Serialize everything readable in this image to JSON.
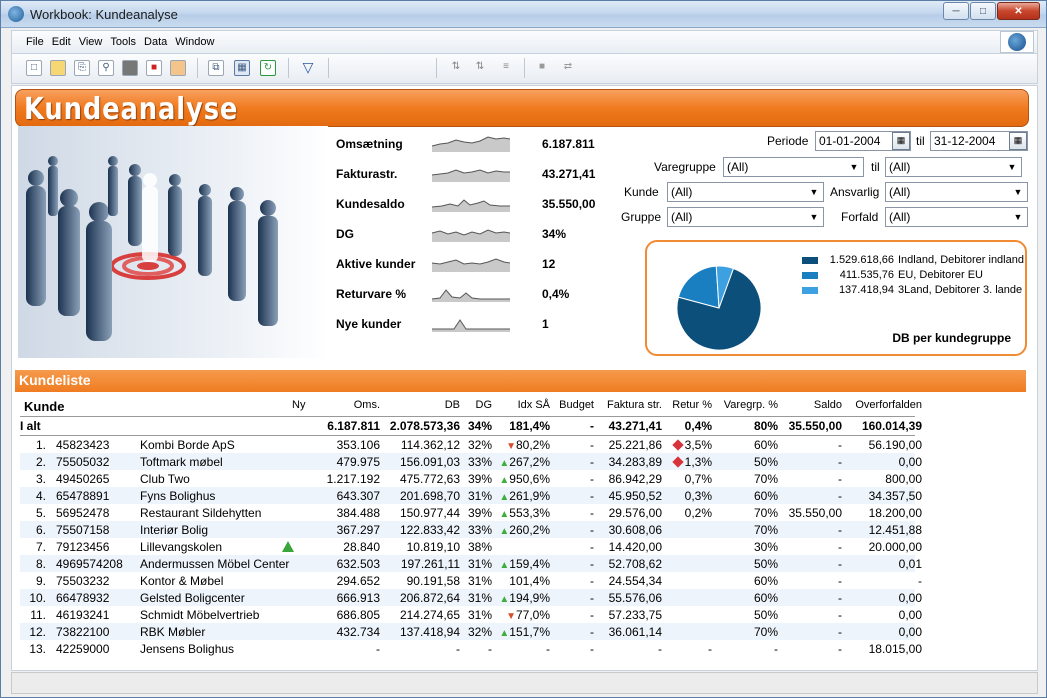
{
  "window": {
    "title": "Workbook: Kundeanalyse"
  },
  "menu": [
    "File",
    "Edit",
    "View",
    "Tools",
    "Data",
    "Window"
  ],
  "banner": {
    "title": "Kundeanalyse"
  },
  "kpis": [
    {
      "label": "Omsætning",
      "value": "6.187.811"
    },
    {
      "label": "Fakturastr.",
      "value": "43.271,41"
    },
    {
      "label": "Kundesaldo",
      "value": "35.550,00"
    },
    {
      "label": "DG",
      "value": "34%"
    },
    {
      "label": "Aktive kunder",
      "value": "12"
    },
    {
      "label": "Returvare %",
      "value": "0,4%"
    },
    {
      "label": "Nye kunder",
      "value": "1"
    }
  ],
  "filters": {
    "periode_label": "Periode",
    "periode_from": "01-01-2004",
    "til_label": "til",
    "periode_to": "31-12-2004",
    "varegruppe_label": "Varegruppe",
    "varegruppe_value": "(All)",
    "varegruppe_til_label": "til",
    "varegruppe_til_value": "(All)",
    "kunde_label": "Kunde",
    "kunde_value": "(All)",
    "ansvarlig_label": "Ansvarlig",
    "ansvarlig_value": "(All)",
    "gruppe_label": "Gruppe",
    "gruppe_value": "(All)",
    "forfald_label": "Forfald",
    "forfald_value": "(All)"
  },
  "chart_data": {
    "type": "pie",
    "title": "DB per kundegruppe",
    "categories": [
      "Indland, Debitorer indland",
      "EU, Debitorer EU",
      "3Land, Debitorer 3. lande"
    ],
    "values": [
      1529618.66,
      411535.76,
      137418.94
    ],
    "value_labels": [
      "1.529.618,66",
      "411.535,76",
      "137.418,94"
    ],
    "colors": [
      "#0b4f7a",
      "#1a7fc1",
      "#3da0e0"
    ],
    "legend": "top-right"
  },
  "kundeliste": {
    "title": "Kundeliste",
    "headers": {
      "kunde": "Kunde",
      "ny": "Ny",
      "oms": "Oms.",
      "db": "DB",
      "dg": "DG",
      "idx": "Idx SÅ",
      "budget": "Budget",
      "faktura": "Faktura str.",
      "retur": "Retur %",
      "varegrp": "Varegrp. %",
      "saldo": "Saldo",
      "overforfalden": "Overforfalden"
    },
    "total": {
      "label": "I alt",
      "oms": "6.187.811",
      "db": "2.078.573,36",
      "dg": "34%",
      "idx": "181,4%",
      "budget": "-",
      "faktura": "43.271,41",
      "retur": "0,4%",
      "varegrp": "80%",
      "saldo": "35.550,00",
      "overforfalden": "160.014,39"
    },
    "rows": [
      {
        "nr": "1.",
        "id": "45823423",
        "name": "Kombi Borde ApS",
        "ny": false,
        "oms": "353.106",
        "db": "114.362,12",
        "dg": "32%",
        "trend": "down",
        "idx": "80,2%",
        "budget": "-",
        "faktura": "25.221,86",
        "retur_flag": true,
        "retur": "3,5%",
        "varegrp": "60%",
        "saldo": "-",
        "overforfalden": "56.190,00"
      },
      {
        "nr": "2.",
        "id": "75505032",
        "name": "Toftmark møbel",
        "ny": false,
        "oms": "479.975",
        "db": "156.091,03",
        "dg": "33%",
        "trend": "up",
        "idx": "267,2%",
        "budget": "-",
        "faktura": "34.283,89",
        "retur_flag": true,
        "retur": "1,3%",
        "varegrp": "50%",
        "saldo": "-",
        "overforfalden": "0,00"
      },
      {
        "nr": "3.",
        "id": "49450265",
        "name": "Club Two",
        "ny": false,
        "oms": "1.217.192",
        "db": "475.772,63",
        "dg": "39%",
        "trend": "up",
        "idx": "950,6%",
        "budget": "-",
        "faktura": "86.942,29",
        "retur_flag": false,
        "retur": "0,7%",
        "varegrp": "70%",
        "saldo": "-",
        "overforfalden": "800,00"
      },
      {
        "nr": "4.",
        "id": "65478891",
        "name": "Fyns Bolighus",
        "ny": false,
        "oms": "643.307",
        "db": "201.698,70",
        "dg": "31%",
        "trend": "up",
        "idx": "261,9%",
        "budget": "-",
        "faktura": "45.950,52",
        "retur_flag": false,
        "retur": "0,3%",
        "varegrp": "60%",
        "saldo": "-",
        "overforfalden": "34.357,50"
      },
      {
        "nr": "5.",
        "id": "56952478",
        "name": "Restaurant Sildehytten",
        "ny": false,
        "oms": "384.488",
        "db": "150.977,44",
        "dg": "39%",
        "trend": "up",
        "idx": "553,3%",
        "budget": "-",
        "faktura": "29.576,00",
        "retur_flag": false,
        "retur": "0,2%",
        "varegrp": "70%",
        "saldo": "35.550,00",
        "overforfalden": "18.200,00"
      },
      {
        "nr": "6.",
        "id": "75507158",
        "name": "Interiør Bolig",
        "ny": false,
        "oms": "367.297",
        "db": "122.833,42",
        "dg": "33%",
        "trend": "up",
        "idx": "260,2%",
        "budget": "-",
        "faktura": "30.608,06",
        "retur_flag": false,
        "retur": "",
        "varegrp": "70%",
        "saldo": "-",
        "overforfalden": "12.451,88"
      },
      {
        "nr": "7.",
        "id": "79123456",
        "name": "Lillevangskolen",
        "ny": true,
        "oms": "28.840",
        "db": "10.819,10",
        "dg": "38%",
        "trend": "",
        "idx": "",
        "budget": "-",
        "faktura": "14.420,00",
        "retur_flag": false,
        "retur": "",
        "varegrp": "30%",
        "saldo": "-",
        "overforfalden": "20.000,00"
      },
      {
        "nr": "8.",
        "id": "4969574208",
        "name": "Andermussen Möbel Center",
        "ny": false,
        "oms": "632.503",
        "db": "197.261,11",
        "dg": "31%",
        "trend": "up",
        "idx": "159,4%",
        "budget": "-",
        "faktura": "52.708,62",
        "retur_flag": false,
        "retur": "",
        "varegrp": "50%",
        "saldo": "-",
        "overforfalden": "0,01"
      },
      {
        "nr": "9.",
        "id": "75503232",
        "name": "Kontor & Møbel",
        "ny": false,
        "oms": "294.652",
        "db": "90.191,58",
        "dg": "31%",
        "trend": "",
        "idx": "101,4%",
        "budget": "-",
        "faktura": "24.554,34",
        "retur_flag": false,
        "retur": "",
        "varegrp": "60%",
        "saldo": "-",
        "overforfalden": "-"
      },
      {
        "nr": "10.",
        "id": "66478932",
        "name": "Gelsted Boligcenter",
        "ny": false,
        "oms": "666.913",
        "db": "206.872,64",
        "dg": "31%",
        "trend": "up",
        "idx": "194,9%",
        "budget": "-",
        "faktura": "55.576,06",
        "retur_flag": false,
        "retur": "",
        "varegrp": "60%",
        "saldo": "-",
        "overforfalden": "0,00"
      },
      {
        "nr": "11.",
        "id": "46193241",
        "name": "Schmidt Möbelvertrieb",
        "ny": false,
        "oms": "686.805",
        "db": "214.274,65",
        "dg": "31%",
        "trend": "down",
        "idx": "77,0%",
        "budget": "-",
        "faktura": "57.233,75",
        "retur_flag": false,
        "retur": "",
        "varegrp": "50%",
        "saldo": "-",
        "overforfalden": "0,00"
      },
      {
        "nr": "12.",
        "id": "73822100",
        "name": "RBK Møbler",
        "ny": false,
        "oms": "432.734",
        "db": "137.418,94",
        "dg": "32%",
        "trend": "up",
        "idx": "151,7%",
        "budget": "-",
        "faktura": "36.061,14",
        "retur_flag": false,
        "retur": "",
        "varegrp": "70%",
        "saldo": "-",
        "overforfalden": "0,00"
      },
      {
        "nr": "13.",
        "id": "42259000",
        "name": "Jensens Bolighus",
        "ny": false,
        "oms": "-",
        "db": "-",
        "dg": "-",
        "trend": "",
        "idx": "-",
        "budget": "-",
        "faktura": "-",
        "retur_flag": false,
        "retur": "-",
        "varegrp": "-",
        "saldo": "-",
        "overforfalden": "18.015,00"
      }
    ]
  }
}
